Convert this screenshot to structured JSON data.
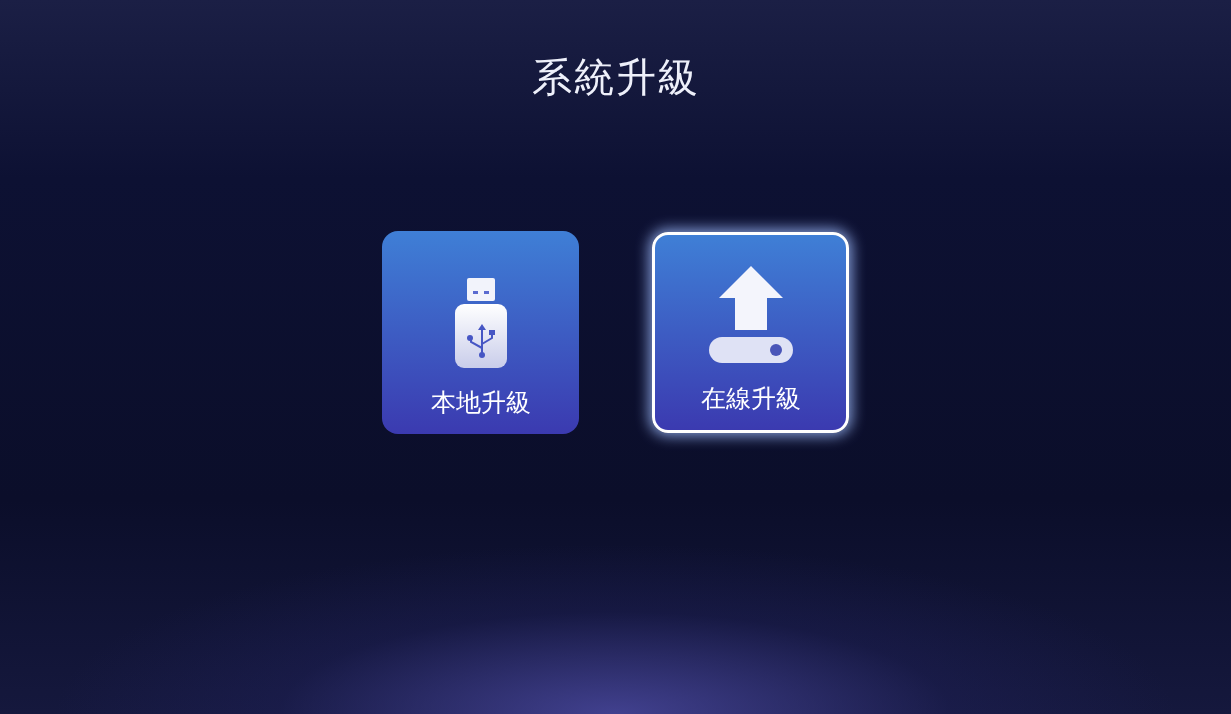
{
  "title": "系統升級",
  "options": [
    {
      "kind": "usb",
      "label": "本地升級",
      "selected": false
    },
    {
      "kind": "upload",
      "label": "在線升級",
      "selected": true
    }
  ]
}
